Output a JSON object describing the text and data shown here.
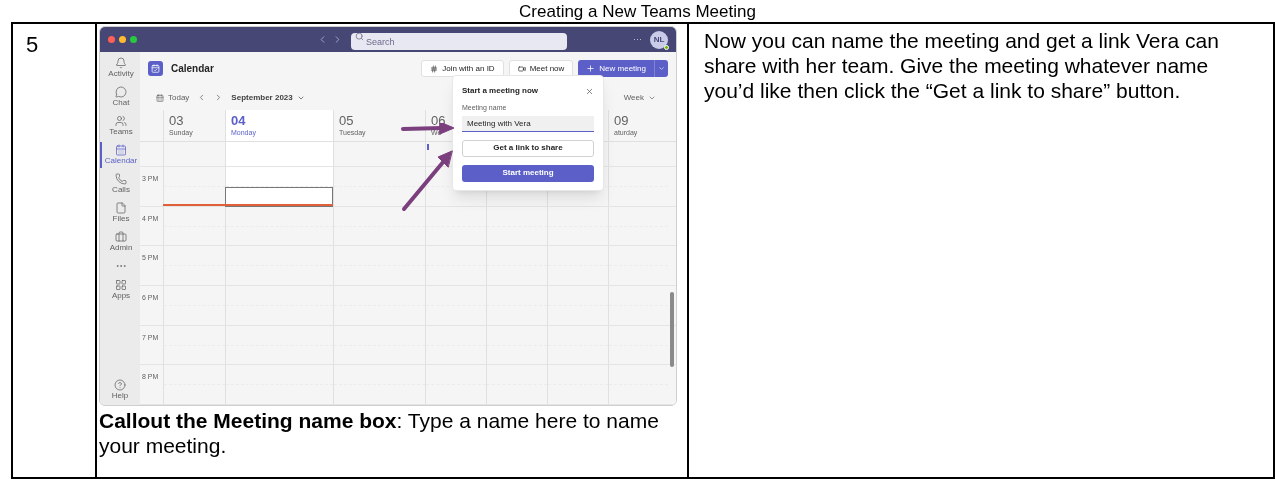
{
  "heading": "Creating a New Teams Meeting",
  "step": "5",
  "app": {
    "title_bar": {
      "search_placeholder": "Search",
      "more": "···",
      "avatar": "NL"
    },
    "rail": [
      {
        "kind": "activity",
        "label": "Activity",
        "selected": false
      },
      {
        "kind": "chat",
        "label": "Chat",
        "selected": false
      },
      {
        "kind": "teams",
        "label": "Teams",
        "selected": false
      },
      {
        "kind": "calendar",
        "label": "Calendar",
        "selected": true
      },
      {
        "kind": "calls",
        "label": "Calls",
        "selected": false
      },
      {
        "kind": "files",
        "label": "Files",
        "selected": false
      },
      {
        "kind": "admin",
        "label": "Admin",
        "selected": false
      },
      {
        "kind": "more",
        "selected": false
      },
      {
        "kind": "apps",
        "label": "Apps",
        "selected": false
      }
    ],
    "help": "Help",
    "header": {
      "title": "Calendar",
      "buttons": [
        {
          "kind": "join",
          "label": "Join with an ID"
        },
        {
          "kind": "meet",
          "label": "Meet now"
        },
        {
          "kind": "new",
          "label": "New meeting"
        }
      ]
    },
    "toolbar": {
      "today": "Today",
      "month": "September 2023",
      "view": "Week"
    },
    "days": [
      {
        "number": "03",
        "name": "Sunday",
        "selected": false
      },
      {
        "number": "04",
        "name": "Monday",
        "selected": true
      },
      {
        "number": "05",
        "name": "Tuesday",
        "selected": false
      },
      {
        "number": "06",
        "name": "We",
        "selected": false
      },
      {
        "number": "09",
        "name": "aturday",
        "selected": false
      }
    ],
    "time_labels": [
      "3 PM",
      "4 PM",
      "5 PM",
      "6 PM",
      "7 PM",
      "8 PM"
    ],
    "popup": {
      "title": "Start a meeting now",
      "field_label": "Meeting name",
      "field_value": "Meeting with Vera",
      "buttons": [
        {
          "kind": "secondary",
          "label": "Get a link to share"
        },
        {
          "kind": "primary",
          "label": "Start meeting"
        }
      ]
    }
  },
  "caption": "**Callout the Meeting name box**: Type a name here to name your meeting.",
  "description": "Now you can name the meeting and get a link Vera can share with her team. Give the meeting whatever name you’d like then click the “Get a link to share” button."
}
